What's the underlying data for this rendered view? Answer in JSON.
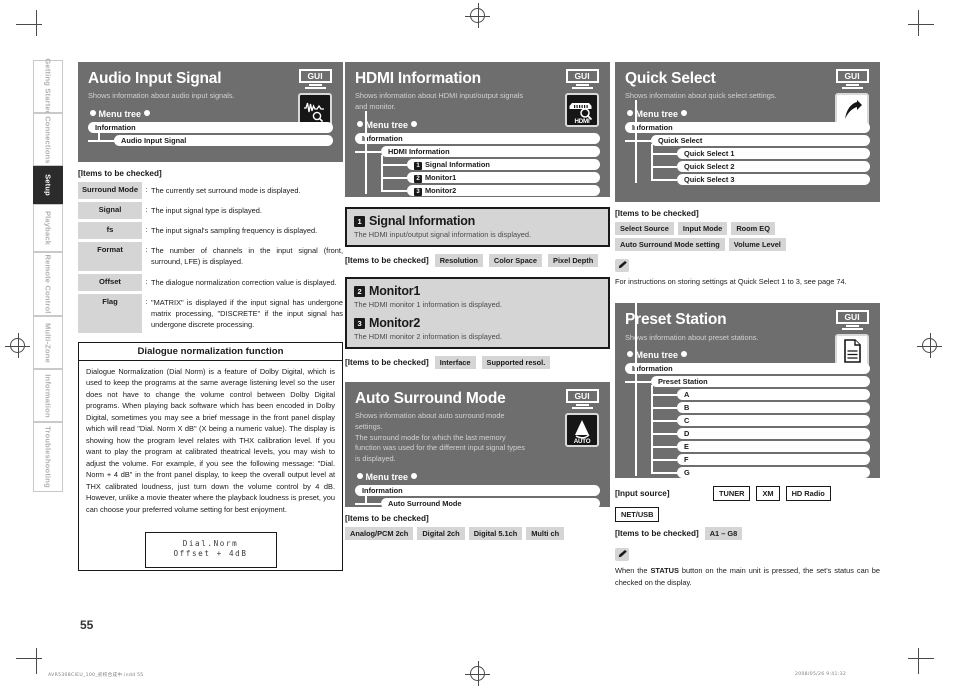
{
  "sidebar": {
    "items": [
      {
        "label": "Getting Started",
        "active": false
      },
      {
        "label": "Connections",
        "active": false
      },
      {
        "label": "Setup",
        "active": true
      },
      {
        "label": "Playback",
        "active": false
      },
      {
        "label": "Remote Control",
        "active": false
      },
      {
        "label": "Multi-Zone",
        "active": false
      },
      {
        "label": "Information",
        "active": false
      },
      {
        "label": "Troubleshooting",
        "active": false
      }
    ]
  },
  "labels": {
    "items_to_be_checked": "[Items to be checked]",
    "input_source": "[Input source]",
    "menu_tree": "Menu tree",
    "gui_badge": "GUI",
    "colon": ":"
  },
  "audio_input_signal": {
    "title": "Audio Input Signal",
    "subtitle": "Shows information about audio input signals.",
    "icon": "waveform-magnifier-icon",
    "tree": {
      "root": "Information",
      "child": "Audio Input Signal"
    },
    "defs": [
      {
        "term": "Surround Mode",
        "desc": "The currently set surround mode is displayed."
      },
      {
        "term": "Signal",
        "desc": "The input signal type is displayed."
      },
      {
        "term": "fs",
        "desc": "The input signal's sampling frequency is displayed."
      },
      {
        "term": "Format",
        "desc": "The number of channels in the input signal (front, surround, LFE) is displayed."
      },
      {
        "term": "Offset",
        "desc": "The dialogue normalization correction value is displayed."
      },
      {
        "term": "Flag",
        "desc": "\"MATRIX\" is displayed if the input signal has undergone matrix processing, \"DISCRETE\" if the input signal has undergone discrete processing."
      }
    ]
  },
  "dialogue_box": {
    "heading": "Dialogue normalization function",
    "body": "Dialogue Normalization (Dial Norm) is a feature of Dolby Digital, which is used to keep the programs at the same average listening level so the user does not have to change the volume control between Dolby Digital programs. When playing back software which has been encoded in Dolby Digital, sometimes you may see a brief message in the front panel display which will read \"Dial. Norm X dB\" (X being a numeric value). The display is showing how the program level relates with THX calibration level. If you want to play the program at calibrated theatrical levels, you may wish to adjust the volume. For example, if you see the following message: \"Dial. Norm + 4 dB\" in the front panel display, to keep the overall output level at THX calibrated loudness, just turn down the volume control by 4 dB. However, unlike a movie theater where the playback loudness is preset, you can choose your preferred volume setting for best enjoyment.",
    "lcd_line1": "Dial.Norm",
    "lcd_line2": "Offset + 4dB"
  },
  "hdmi_information": {
    "title": "HDMI Information",
    "subtitle": "Shows information about HDMI input/output signals and monitor.",
    "icon": "hdmi-magnifier-icon",
    "icon_caption": "HDMI",
    "tree": {
      "root": "Information",
      "child": "HDMI Information",
      "grandchildren": [
        {
          "num": "1",
          "label": "Signal Information"
        },
        {
          "num": "2",
          "label": "Monitor1"
        },
        {
          "num": "3",
          "label": "Monitor2"
        }
      ]
    },
    "signal_block": {
      "num": "1",
      "title": "Signal Information",
      "desc": "The HDMI input/output signal information is displayed.",
      "chips": [
        "Resolution",
        "Color Space",
        "Pixel Depth"
      ]
    },
    "monitor_block": {
      "num1": "2",
      "title1": "Monitor1",
      "desc1": "The HDMI monitor 1 information is displayed.",
      "num2": "3",
      "title2": "Monitor2",
      "desc2": "The HDMI monitor 2 information is displayed.",
      "chips": [
        "Interface",
        "Supported resol."
      ]
    }
  },
  "auto_surround_mode": {
    "title": "Auto Surround Mode",
    "subtitle": "Shows information about auto surround mode settings.\nThe surround mode for which the last memory function was used for the different input signal types is displayed.",
    "icon": "auto-surround-icon",
    "icon_caption": "AUTO",
    "tree": {
      "root": "Information",
      "child": "Auto Surround Mode"
    },
    "chips": [
      "Analog/PCM 2ch",
      "Digital 2ch",
      "Digital 5.1ch",
      "Multi ch"
    ]
  },
  "quick_select": {
    "title": "Quick Select",
    "subtitle": "Shows information about quick select settings.",
    "icon": "arrow-shortcut-icon",
    "tree": {
      "root": "Information",
      "child": "Quick Select",
      "grandchildren": [
        "Quick Select 1",
        "Quick Select 2",
        "Quick Select 3"
      ]
    },
    "chips_row1": [
      "Select Source",
      "Input Mode",
      "Room EQ"
    ],
    "chips_row2": [
      "Auto Surround Mode setting",
      "Volume Level"
    ],
    "note_icon": "pencil-icon",
    "note": "For instructions on storing settings at Quick Select 1 to 3, see page 74."
  },
  "preset_station": {
    "title": "Preset Station",
    "subtitle": "Shows information about preset stations.",
    "icon": "document-icon",
    "tree": {
      "root": "Information",
      "child": "Preset Station",
      "grandchildren": [
        "A",
        "B",
        "C",
        "D",
        "E",
        "F",
        "G"
      ]
    },
    "input_sources": [
      "TUNER",
      "XM",
      "HD Radio",
      "NET/USB"
    ],
    "check_chip": "A1 – G8",
    "note_icon": "pencil-icon",
    "note_pre": "When the ",
    "note_bold": "STATUS",
    "note_post": " button on the main unit is pressed, the set's status can be checked on the display."
  },
  "page": {
    "number": "55",
    "footer_left": "AVR5308CIEU_100_初校合成中.indd   55",
    "footer_right": "2008/05/26   9:41:32"
  }
}
